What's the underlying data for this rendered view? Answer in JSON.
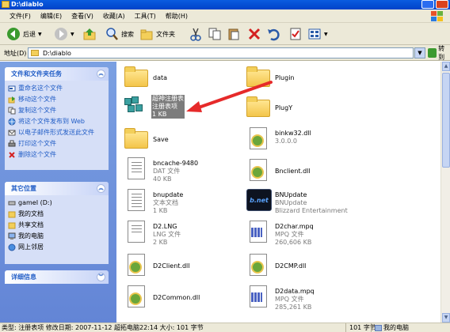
{
  "window": {
    "title": "D:\\diablo"
  },
  "menu": [
    "文件(F)",
    "编辑(E)",
    "查看(V)",
    "收藏(A)",
    "工具(T)",
    "帮助(H)"
  ],
  "toolbar": {
    "back": "后退",
    "search": "搜索",
    "folders": "文件夹"
  },
  "address": {
    "label": "地址(D)",
    "path": "D:\\diablo",
    "go": "转到"
  },
  "tasks": {
    "title": "文件和文件夹任务",
    "items": [
      {
        "label": "重命名这个文件",
        "icon": "rename-icon"
      },
      {
        "label": "移动这个文件",
        "icon": "move-icon"
      },
      {
        "label": "复制这个文件",
        "icon": "copy-icon"
      },
      {
        "label": "将这个文件发布到 Web",
        "icon": "publish-web-icon"
      },
      {
        "label": "以电子邮件形式发送此文件",
        "icon": "email-icon"
      },
      {
        "label": "打印这个文件",
        "icon": "print-icon"
      },
      {
        "label": "删除这个文件",
        "icon": "delete-icon"
      }
    ]
  },
  "places": {
    "title": "其它位置",
    "items": [
      {
        "label": "gameI (D:)",
        "icon": "drive-icon"
      },
      {
        "label": "我的文档",
        "icon": "my-documents-icon"
      },
      {
        "label": "共享文档",
        "icon": "shared-documents-icon"
      },
      {
        "label": "我的电脑",
        "icon": "my-computer-icon"
      },
      {
        "label": "网上邻居",
        "icon": "network-places-icon"
      }
    ]
  },
  "details": {
    "title": "详细信息"
  },
  "files": [
    {
      "name": "data",
      "type": "folder"
    },
    {
      "name": "Plugin",
      "type": "folder"
    },
    {
      "name": "超神注册表",
      "sub": "注册表项",
      "size": "1 KB",
      "type": "registry",
      "selected": true
    },
    {
      "name": "PlugY",
      "type": "folder"
    },
    {
      "name": "Save",
      "type": "folder"
    },
    {
      "name": "binkw32.dll",
      "sub": "3.0.0.0",
      "type": "dll"
    },
    {
      "name": "bncache-9480",
      "sub": "DAT 文件",
      "size": "40 KB",
      "type": "doc"
    },
    {
      "name": "Bnclient.dll",
      "type": "dll"
    },
    {
      "name": "bnupdate",
      "sub": "文本文档",
      "size": "1 KB",
      "type": "text"
    },
    {
      "name": "BNUpdate",
      "sub": "BNUpdate",
      "size": "Blizzard Entertainment",
      "type": "bnet"
    },
    {
      "name": "D2.LNG",
      "sub": "LNG 文件",
      "size": "2 KB",
      "type": "doc"
    },
    {
      "name": "D2char.mpq",
      "sub": "MPQ 文件",
      "size": "260,606 KB",
      "type": "mpq"
    },
    {
      "name": "D2Client.dll",
      "type": "dll"
    },
    {
      "name": "D2CMP.dll",
      "type": "dll"
    },
    {
      "name": "D2Common.dll",
      "type": "dll"
    },
    {
      "name": "D2data.mpq",
      "sub": "MPQ 文件",
      "size": "285,261 KB",
      "type": "mpq"
    }
  ],
  "status": {
    "info": "类型: 注册表项 修改日期: 2007-11-12 超拓电脑22:14 大小: 101 字节",
    "size": "101 字节",
    "location": "我的电脑"
  },
  "bnet_logo": "b.net",
  "colors": {
    "arrow": "#e62a2a",
    "title_bar": "#0a5ce0",
    "task_pane": "#6f93dc",
    "selection": "#7c7c7c"
  }
}
